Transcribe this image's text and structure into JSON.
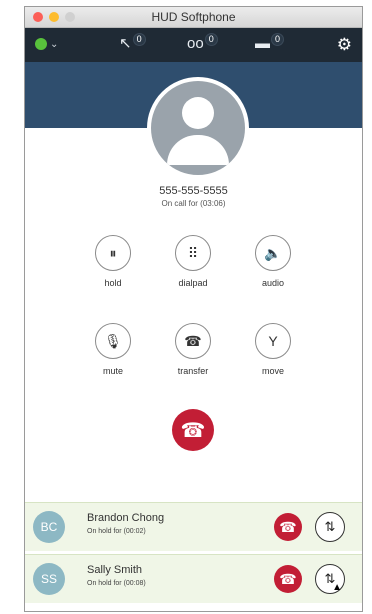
{
  "window": {
    "title": "HUD Softphone"
  },
  "topbar": {
    "status_color": "#58c13c",
    "items": [
      {
        "icon": "missed-calls-icon",
        "glyph": "↖",
        "count": "0"
      },
      {
        "icon": "voicemail-icon",
        "glyph": "oo",
        "count": "0"
      },
      {
        "icon": "chat-icon",
        "glyph": "▬",
        "count": "0"
      }
    ],
    "settings_icon": "gear-icon"
  },
  "call": {
    "number": "555-555-5555",
    "status": "On call for (03:06)"
  },
  "controls": [
    {
      "label": "hold",
      "glyph": "⏸",
      "icon": "pause-icon"
    },
    {
      "label": "dialpad",
      "glyph": "⠿",
      "icon": "dialpad-icon"
    },
    {
      "label": "audio",
      "glyph": "🔈",
      "icon": "speaker-icon"
    },
    {
      "label": "mute",
      "glyph": "🎙",
      "icon": "microphone-icon"
    },
    {
      "label": "transfer",
      "glyph": "☎",
      "icon": "transfer-icon"
    },
    {
      "label": "move",
      "glyph": "Y",
      "icon": "move-icon"
    }
  ],
  "hold_calls": [
    {
      "initials": "BC",
      "name": "Brandon Chong",
      "status": "On hold for (00:02)"
    },
    {
      "initials": "SS",
      "name": "Sally Smith",
      "status": "On hold for (00:08)"
    }
  ],
  "colors": {
    "hangup": "#c21e35",
    "header": "#2f4e6e",
    "topbar": "#1f2a35"
  }
}
